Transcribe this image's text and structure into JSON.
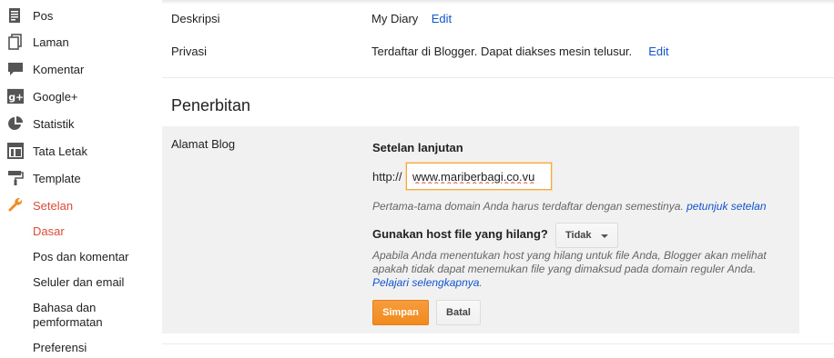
{
  "sidebar": {
    "items": [
      {
        "label": "Pos",
        "icon": "posts-icon"
      },
      {
        "label": "Laman",
        "icon": "pages-icon"
      },
      {
        "label": "Komentar",
        "icon": "comment-icon"
      },
      {
        "label": "Google+",
        "icon": "google-plus-icon"
      },
      {
        "label": "Statistik",
        "icon": "pie-chart-icon"
      },
      {
        "label": "Tata Letak",
        "icon": "layout-icon"
      },
      {
        "label": "Template",
        "icon": "paint-roller-icon"
      },
      {
        "label": "Setelan",
        "icon": "wrench-icon",
        "active": true
      }
    ],
    "subitems": [
      {
        "label": "Dasar",
        "active": true
      },
      {
        "label": "Pos dan komentar"
      },
      {
        "label": "Seluler dan email"
      },
      {
        "label_line1": "Bahasa dan",
        "label_line2": "pemformatan"
      },
      {
        "label": "Preferensi"
      }
    ]
  },
  "settings": {
    "description": {
      "label": "Deskripsi",
      "value": "My Diary",
      "edit": "Edit"
    },
    "privacy": {
      "label": "Privasi",
      "value": "Terdaftar di Blogger. Dapat diakses mesin telusur.",
      "edit": "Edit"
    }
  },
  "publishing": {
    "section_title": "Penerbitan",
    "blog_address_label": "Alamat Blog",
    "advanced_title": "Setelan lanjutan",
    "http_prefix": "http://",
    "domain_value": "www.mariberbagi.co.vu",
    "hint_text": "Pertama-tama domain Anda harus terdaftar dengan semestinya.",
    "hint_link": "petunjuk setelan",
    "host_question": "Gunakan host file yang hilang?",
    "host_select_value": "Tidak",
    "host_desc": "Apabila Anda menentukan host yang hilang untuk file Anda, Blogger akan melihat apakah tidak dapat menemukan file yang dimaksud pada domain reguler Anda.",
    "learn_more": "Pelajari selengkapnya",
    "learn_more_suffix": ".",
    "save_label": "Simpan",
    "cancel_label": "Batal"
  },
  "colors": {
    "accent": "#dd4b39",
    "link": "#1155cc",
    "save_button": "#f08b1d"
  }
}
